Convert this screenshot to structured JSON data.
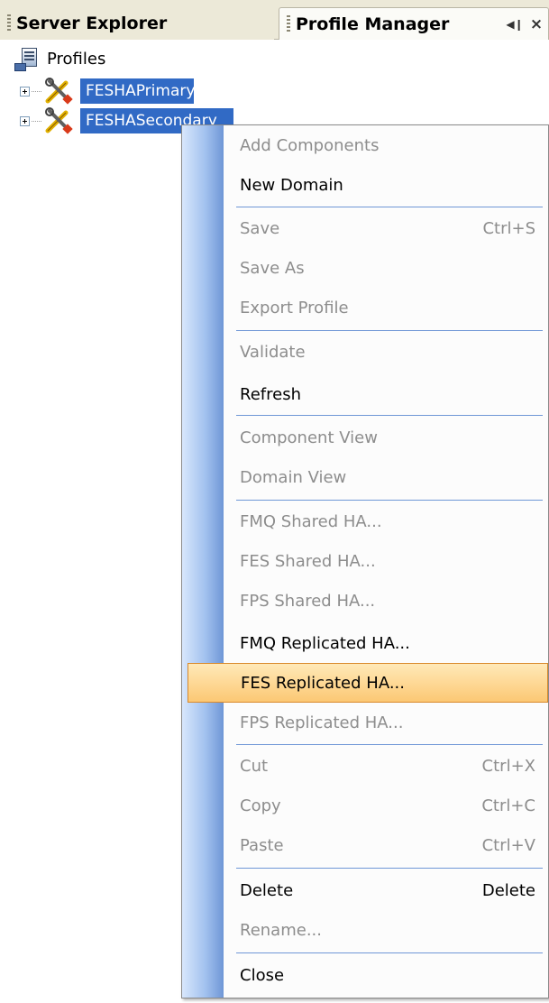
{
  "tabs": {
    "server_explorer": "Server Explorer",
    "profile_manager": "Profile Manager",
    "pin_glyph": "◀❙",
    "close_glyph": "×"
  },
  "tree": {
    "root_label": "Profiles",
    "items": [
      {
        "label": "FESHAPrimary",
        "icon": "tools-icon",
        "selected": true
      },
      {
        "label": "FESHASecondary",
        "icon": "tools-icon",
        "selected": true
      }
    ]
  },
  "menu": {
    "items": [
      {
        "label": "Add Components",
        "shortcut": "",
        "enabled": false
      },
      {
        "label": "New Domain",
        "shortcut": "",
        "enabled": true
      },
      {
        "label": "Save",
        "shortcut": "Ctrl+S",
        "enabled": false
      },
      {
        "label": "Save As",
        "shortcut": "",
        "enabled": false
      },
      {
        "label": "Export Profile",
        "shortcut": "",
        "enabled": false
      },
      {
        "label": "Validate",
        "shortcut": "",
        "enabled": false
      },
      {
        "label": "Refresh",
        "shortcut": "",
        "enabled": true
      },
      {
        "label": "Component View",
        "shortcut": "",
        "enabled": false
      },
      {
        "label": "Domain View",
        "shortcut": "",
        "enabled": false
      },
      {
        "label": "FMQ Shared HA...",
        "shortcut": "",
        "enabled": false
      },
      {
        "label": "FES Shared HA...",
        "shortcut": "",
        "enabled": false
      },
      {
        "label": "FPS Shared HA...",
        "shortcut": "",
        "enabled": false
      },
      {
        "label": "FMQ Replicated HA...",
        "shortcut": "",
        "enabled": true
      },
      {
        "label": "FES Replicated HA...",
        "shortcut": "",
        "enabled": true,
        "highlighted": true
      },
      {
        "label": "FPS Replicated HA...",
        "shortcut": "",
        "enabled": false
      },
      {
        "label": "Cut",
        "shortcut": "Ctrl+X",
        "enabled": false
      },
      {
        "label": "Copy",
        "shortcut": "Ctrl+C",
        "enabled": false
      },
      {
        "label": "Paste",
        "shortcut": "Ctrl+V",
        "enabled": false
      },
      {
        "label": "Delete",
        "shortcut": "Delete",
        "enabled": true
      },
      {
        "label": "Rename...",
        "shortcut": "",
        "enabled": false
      },
      {
        "label": "Close",
        "shortcut": "",
        "enabled": true
      }
    ]
  },
  "colors": {
    "selection": "#316ac5",
    "highlight": "#fcc874",
    "disabled_text": "#8d8d8d"
  }
}
